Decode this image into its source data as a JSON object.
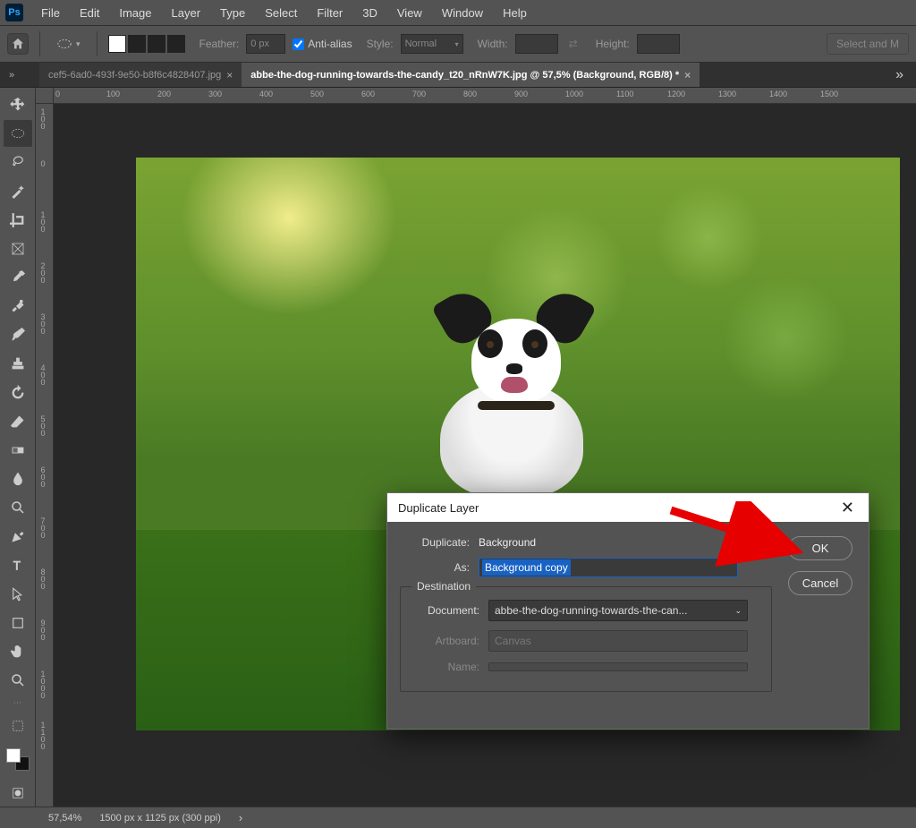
{
  "menu": [
    "File",
    "Edit",
    "Image",
    "Layer",
    "Type",
    "Select",
    "Filter",
    "3D",
    "View",
    "Window",
    "Help"
  ],
  "options": {
    "feather_label": "Feather:",
    "feather_val": "0 px",
    "antialias": "Anti-alias",
    "style_label": "Style:",
    "style_val": "Normal",
    "width_label": "Width:",
    "width_val": "",
    "height_label": "Height:",
    "height_val": "",
    "select_mask": "Select and M"
  },
  "tabs": [
    {
      "title": "cef5-6ad0-493f-9e50-b8f6c4828407.jpg",
      "active": false
    },
    {
      "title": "abbe-the-dog-running-towards-the-candy_t20_nRnW7K.jpg @ 57,5% (Background, RGB/8) *",
      "active": true
    }
  ],
  "ruler_h": [
    "0",
    "100",
    "200",
    "300",
    "400",
    "500",
    "600",
    "700",
    "800",
    "900",
    "1000",
    "1100",
    "1200",
    "1300",
    "1400",
    "1500"
  ],
  "ruler_v": [
    "100",
    "0",
    "100",
    "200",
    "300",
    "400",
    "500",
    "600",
    "700",
    "800",
    "900",
    "1000",
    "1100"
  ],
  "dialog": {
    "title": "Duplicate Layer",
    "dup_label": "Duplicate:",
    "dup_val": "Background",
    "as_label": "As:",
    "as_val": "Background copy",
    "dest_legend": "Destination",
    "doc_label": "Document:",
    "doc_val": "abbe-the-dog-running-towards-the-can...",
    "art_label": "Artboard:",
    "art_val": "Canvas",
    "name_label": "Name:",
    "name_val": "",
    "ok": "OK",
    "cancel": "Cancel"
  },
  "status": {
    "zoom": "57,54%",
    "dims": "1500 px x 1125 px (300 ppi)"
  }
}
